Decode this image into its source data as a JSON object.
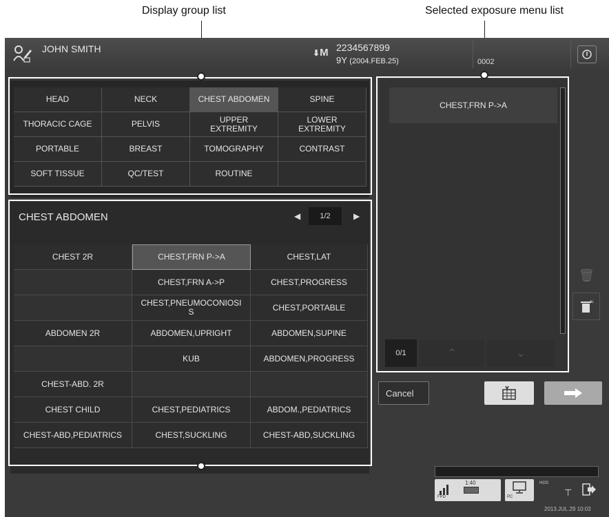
{
  "callouts": {
    "display_group_list": "Display group list",
    "selected_exposure_menu_list": "Selected exposure menu list"
  },
  "patient": {
    "name": "JOHN SMITH",
    "sex": "M",
    "id": "2234567899",
    "age": "9Y",
    "birth": "(2004.FEB.25)",
    "code": "0002"
  },
  "groups": [
    [
      "HEAD",
      "NECK",
      "CHEST ABDOMEN",
      "SPINE"
    ],
    [
      "THORACIC CAGE",
      "PELVIS",
      "UPPER\nEXTREMITY",
      "LOWER\nEXTREMITY"
    ],
    [
      "PORTABLE",
      "BREAST",
      "TOMOGRAPHY",
      "CONTRAST"
    ],
    [
      "SOFT TISSUE",
      "QC/TEST",
      "ROUTINE",
      ""
    ]
  ],
  "selected_group": "CHEST ABDOMEN",
  "menu": {
    "title": "CHEST ABDOMEN",
    "page": "1/2",
    "rows": [
      [
        "CHEST 2R",
        "CHEST,FRN P->A",
        "CHEST,LAT"
      ],
      [
        "",
        "CHEST,FRN A->P",
        "CHEST,PROGRESS"
      ],
      [
        "",
        "CHEST,PNEUMOCONIOSI\nS",
        "CHEST,PORTABLE"
      ],
      [
        "ABDOMEN 2R",
        "ABDOMEN,UPRIGHT",
        "ABDOMEN,SUPINE"
      ],
      [
        "",
        "KUB",
        "ABDOMEN,PROGRESS"
      ],
      [
        "CHEST-ABD. 2R",
        "",
        ""
      ],
      [
        "CHEST CHILD",
        "CHEST,PEDIATRICS",
        "ABDOM.,PEDIATRICS"
      ],
      [
        "CHEST-ABD,PEDIATRICS",
        "CHEST,SUCKLING",
        "CHEST-ABD,SUCKLING"
      ]
    ]
  },
  "selected_list": {
    "items": [
      "CHEST,FRN P->A"
    ],
    "counter": "0/1"
  },
  "buttons": {
    "cancel": "Cancel"
  },
  "status": {
    "time_small": "1:40",
    "fpd": "FPD",
    "pc": "PC",
    "hos": "HOS",
    "datetime": "2013.JUL.29 10:03"
  },
  "colors": {
    "screen_bg": "#3a3a3a",
    "cell_bg": "#2e2e2e",
    "selected_bg": "#555555",
    "text": "#e6e6e6"
  }
}
